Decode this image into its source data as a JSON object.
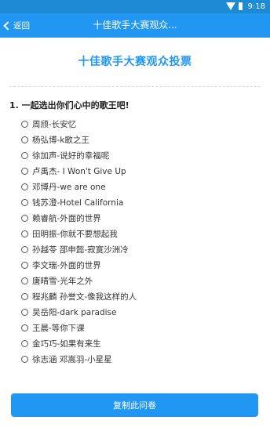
{
  "status_bar": {
    "time": "9:18"
  },
  "nav": {
    "back_label": "返回",
    "title": "十佳歌手大赛观众..."
  },
  "page": {
    "title": "十佳歌手大赛观众投票"
  },
  "question": {
    "title": "1. 一起选出你们心中的歌王吧!",
    "options": [
      "周颀-长安忆",
      "杨弘博-k歌之王",
      "徐加声-说好的幸福呢",
      "卢禹杰- I Won't Give Up",
      "邓博丹-we are one",
      "钱苏澄-Hotel California",
      "赖睿航-外面的世界",
      "田明振-你就不要想起我",
      "孙越苓 邵申懿-寂寞沙洲冷",
      "李文瑞-外面的世界",
      "唐晴雪-光年之外",
      "程兆麟 孙誉文-像我这样的人",
      "吴岳阳-dark paradise",
      "王晨-等你下课",
      "金巧巧-如果有来生",
      "徐志涵 邓嵩羽-小星星"
    ]
  },
  "footer": {
    "copy_button_label": "复制此问卷"
  },
  "colors": {
    "status_bar": "#1c8ad4",
    "primary": "#2196f3"
  },
  "icons": {
    "back": "chevron-left-icon",
    "wifi": "wifi-icon",
    "battery": "battery-icon"
  }
}
